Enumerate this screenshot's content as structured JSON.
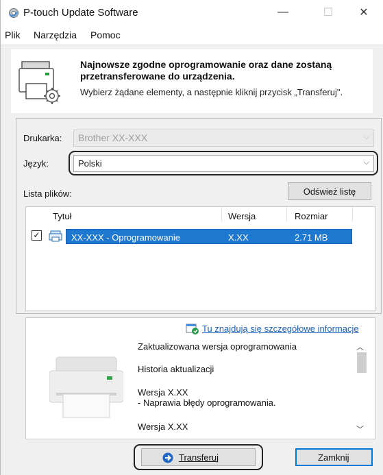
{
  "window": {
    "title": "P-touch Update Software",
    "minimize": "—",
    "maximize": "☐",
    "close": "✕"
  },
  "menu": {
    "items": [
      "Plik",
      "Narzędzia",
      "Pomoc"
    ]
  },
  "header": {
    "title_line1": "Najnowsze zgodne oprogramowanie oraz dane zostaną",
    "title_line2": "przetransferowane do urządzenia.",
    "subtitle": "Wybierz żądane elementy, a następnie kliknij przycisk „Transferuj\"."
  },
  "form": {
    "printer_label": "Drukarka:",
    "printer_value": "Brother XX-XXX",
    "language_label": "Język:",
    "language_value": "Polski",
    "file_list_label": "Lista plików:",
    "refresh_button": "Odśwież listę"
  },
  "table": {
    "columns": [
      "Tytuł",
      "Wersja",
      "Rozmiar"
    ],
    "rows": [
      {
        "checked": true,
        "title": "XX-XXX  - Oprogramowanie",
        "version": "X.XX",
        "size": "2.71 MB"
      }
    ]
  },
  "details": {
    "link": "Tu znajdują się szczegółowe informacje",
    "lines": [
      "Zaktualizowana wersja oprogramowania",
      "Historia aktualizacji",
      "Wersja X.XX",
      "- Naprawia błędy oprogramowania.",
      "Wersja X.XX"
    ]
  },
  "buttons": {
    "transfer": "Transferuj",
    "close": "Zamknij"
  },
  "colors": {
    "selection": "#1e78d0",
    "link": "#1b5fbd",
    "focus_border": "#0078d7"
  }
}
